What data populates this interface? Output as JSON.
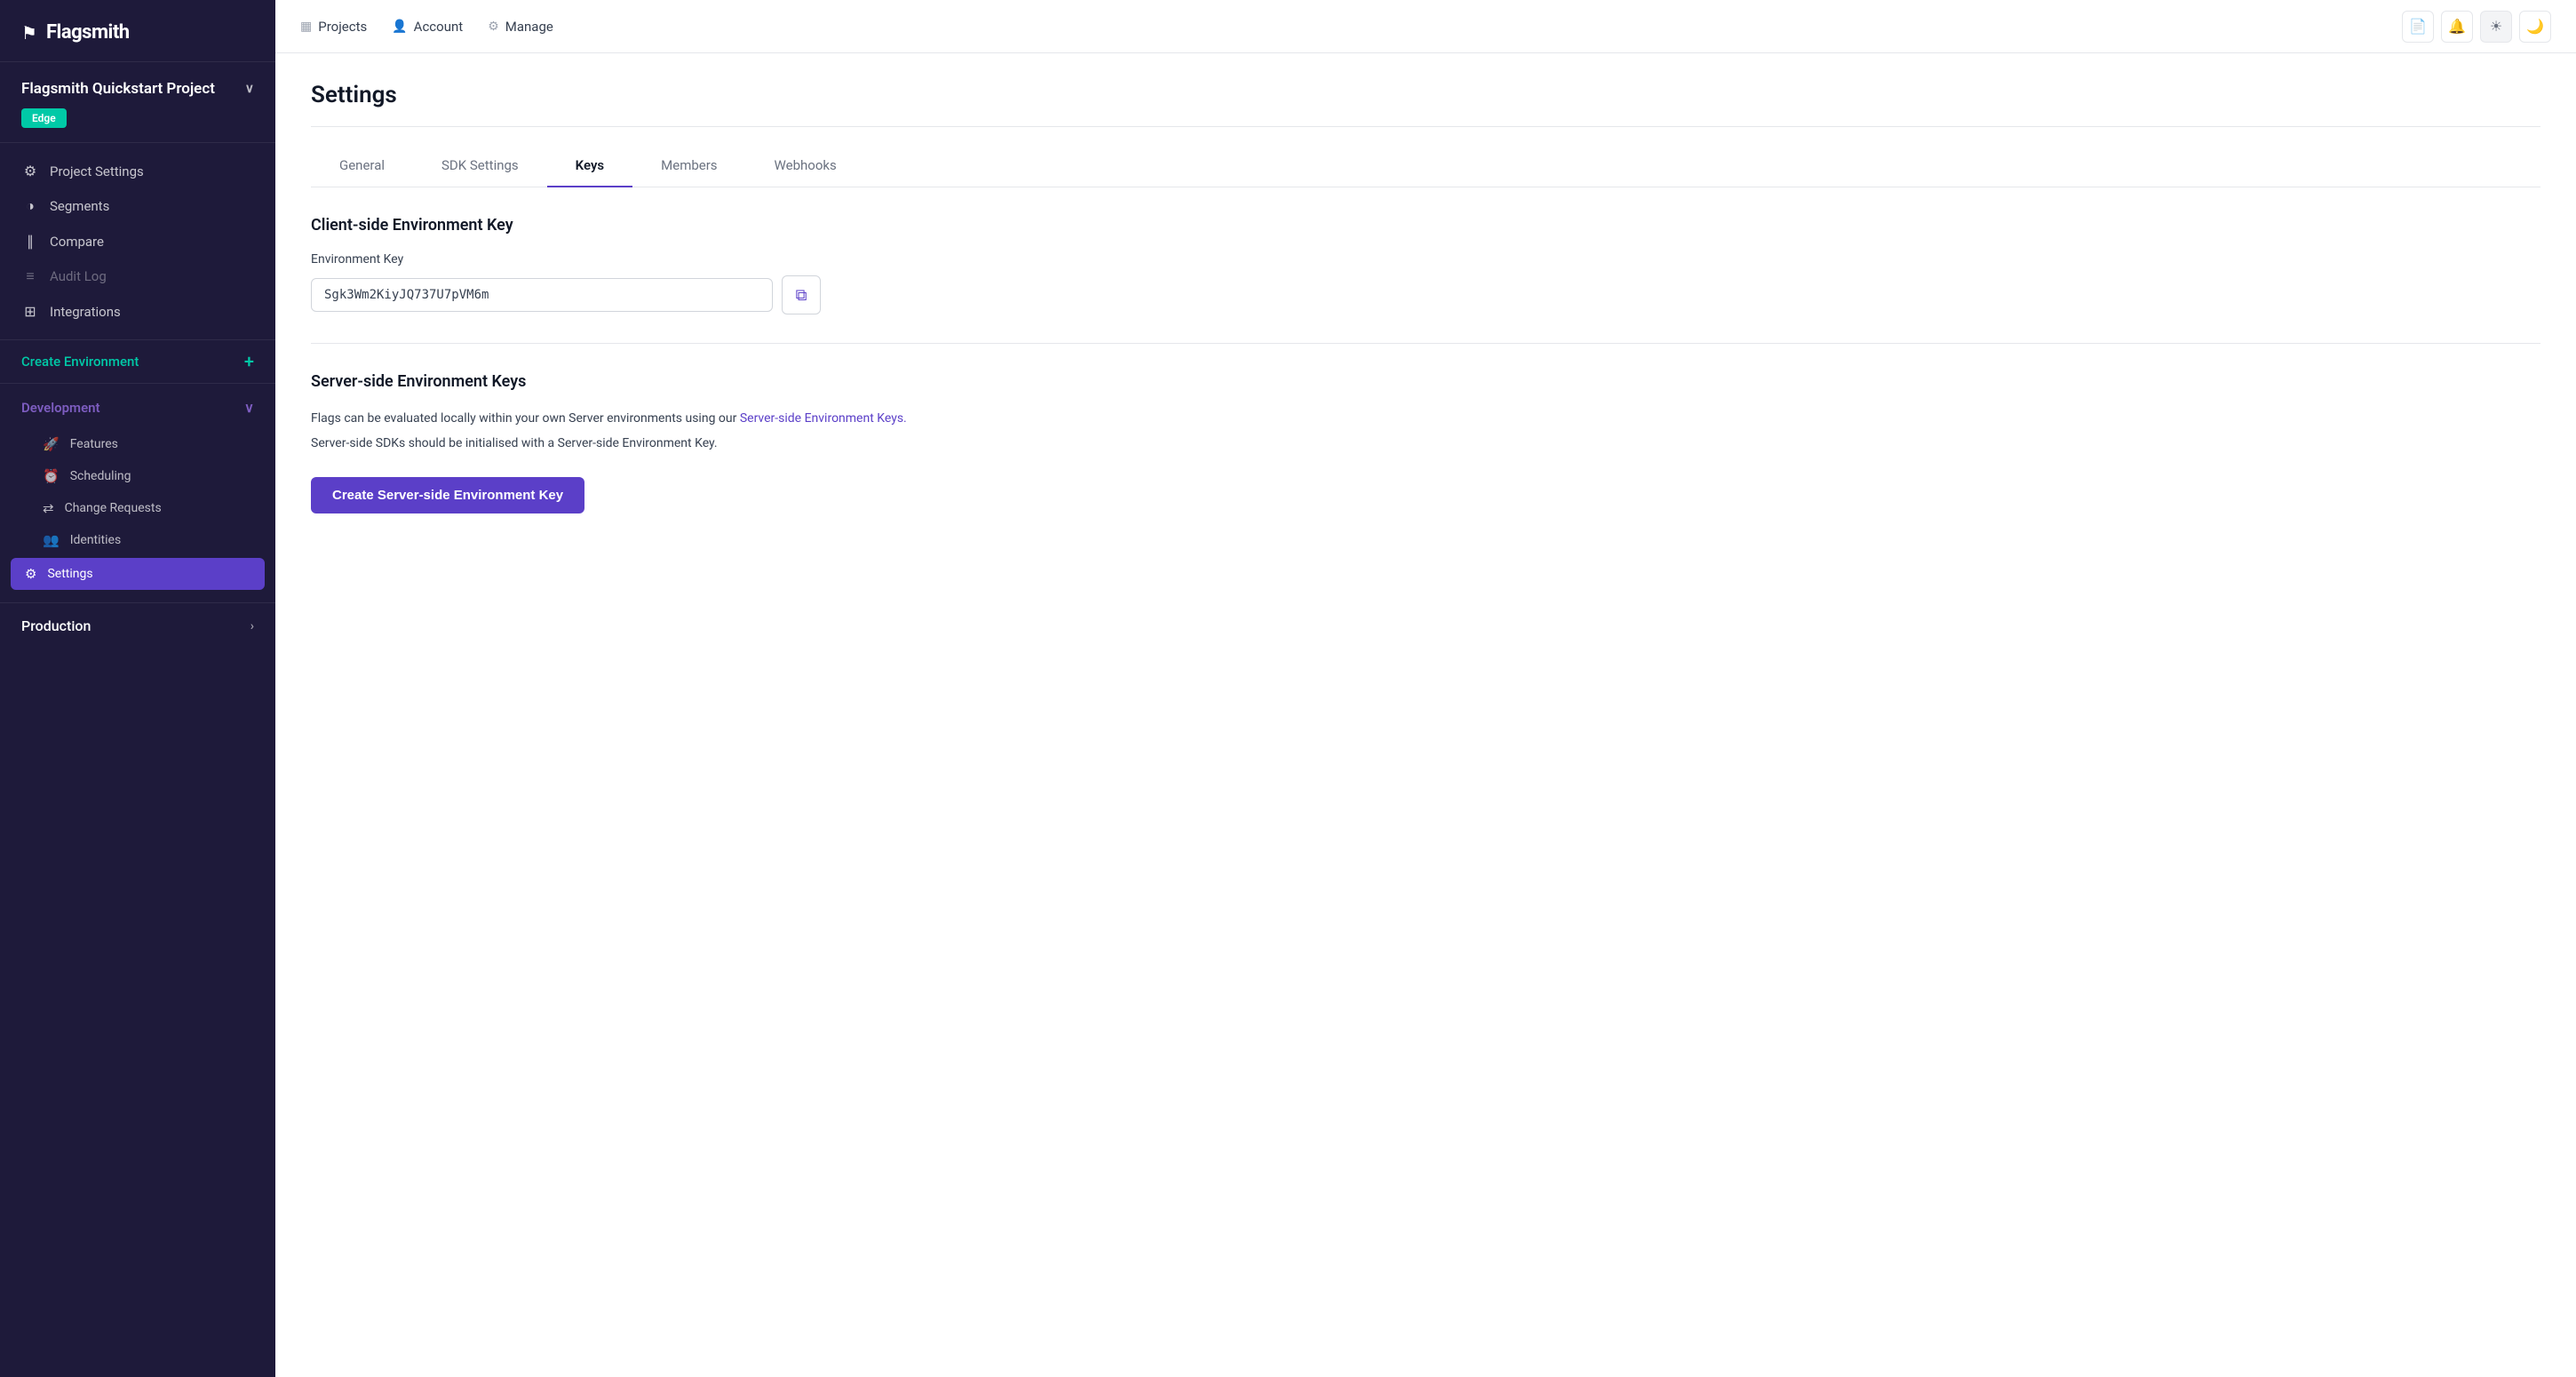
{
  "app": {
    "logo": "Flagsmith",
    "logo_icon": "⚑"
  },
  "sidebar": {
    "project_name": "Flagsmith Quickstart Project",
    "edge_badge": "Edge",
    "nav_items": [
      {
        "id": "project-settings",
        "label": "Project Settings",
        "icon": "⚙"
      },
      {
        "id": "segments",
        "label": "Segments",
        "icon": "◑"
      },
      {
        "id": "compare",
        "label": "Compare",
        "icon": "∥"
      },
      {
        "id": "audit-log",
        "label": "Audit Log",
        "icon": "≡",
        "muted": true
      },
      {
        "id": "integrations",
        "label": "Integrations",
        "icon": "⊞"
      }
    ],
    "create_env_label": "Create Environment",
    "development_env": {
      "label": "Development",
      "sub_items": [
        {
          "id": "features",
          "label": "Features",
          "icon": "🚀"
        },
        {
          "id": "scheduling",
          "label": "Scheduling",
          "icon": "⏰"
        },
        {
          "id": "change-requests",
          "label": "Change Requests",
          "icon": "⇄"
        },
        {
          "id": "identities",
          "label": "Identities",
          "icon": "👥"
        },
        {
          "id": "settings",
          "label": "Settings",
          "icon": "⚙",
          "active": true
        }
      ]
    },
    "production_env": {
      "label": "Production"
    }
  },
  "topnav": {
    "items": [
      {
        "id": "projects",
        "label": "Projects",
        "icon": "▦"
      },
      {
        "id": "account",
        "label": "Account",
        "icon": "👤"
      },
      {
        "id": "manage",
        "label": "Manage",
        "icon": "⚙"
      }
    ],
    "actions": [
      {
        "id": "docs",
        "icon": "📄"
      },
      {
        "id": "notifications",
        "icon": "🔔"
      },
      {
        "id": "light-mode",
        "icon": "☀"
      },
      {
        "id": "dark-mode",
        "icon": "🌙"
      }
    ]
  },
  "page": {
    "title": "Settings",
    "tabs": [
      {
        "id": "general",
        "label": "General",
        "active": false
      },
      {
        "id": "sdk-settings",
        "label": "SDK Settings",
        "active": false
      },
      {
        "id": "keys",
        "label": "Keys",
        "active": true
      },
      {
        "id": "members",
        "label": "Members",
        "active": false
      },
      {
        "id": "webhooks",
        "label": "Webhooks",
        "active": false
      }
    ]
  },
  "client_side": {
    "section_title": "Client-side Environment Key",
    "field_label": "Environment Key",
    "env_key_value": "Sgk3Wm2KiyJQ737U7pVM6m",
    "copy_title": "Copy"
  },
  "server_side": {
    "section_title": "Server-side Environment Keys",
    "desc_line1": "Flags can be evaluated locally within your own Server environments using our",
    "link_text": "Server-side Environment Keys.",
    "desc_line2": "Server-side SDKs should be initialised with a Server-side Environment Key.",
    "create_btn_label": "Create Server-side Environment Key"
  }
}
